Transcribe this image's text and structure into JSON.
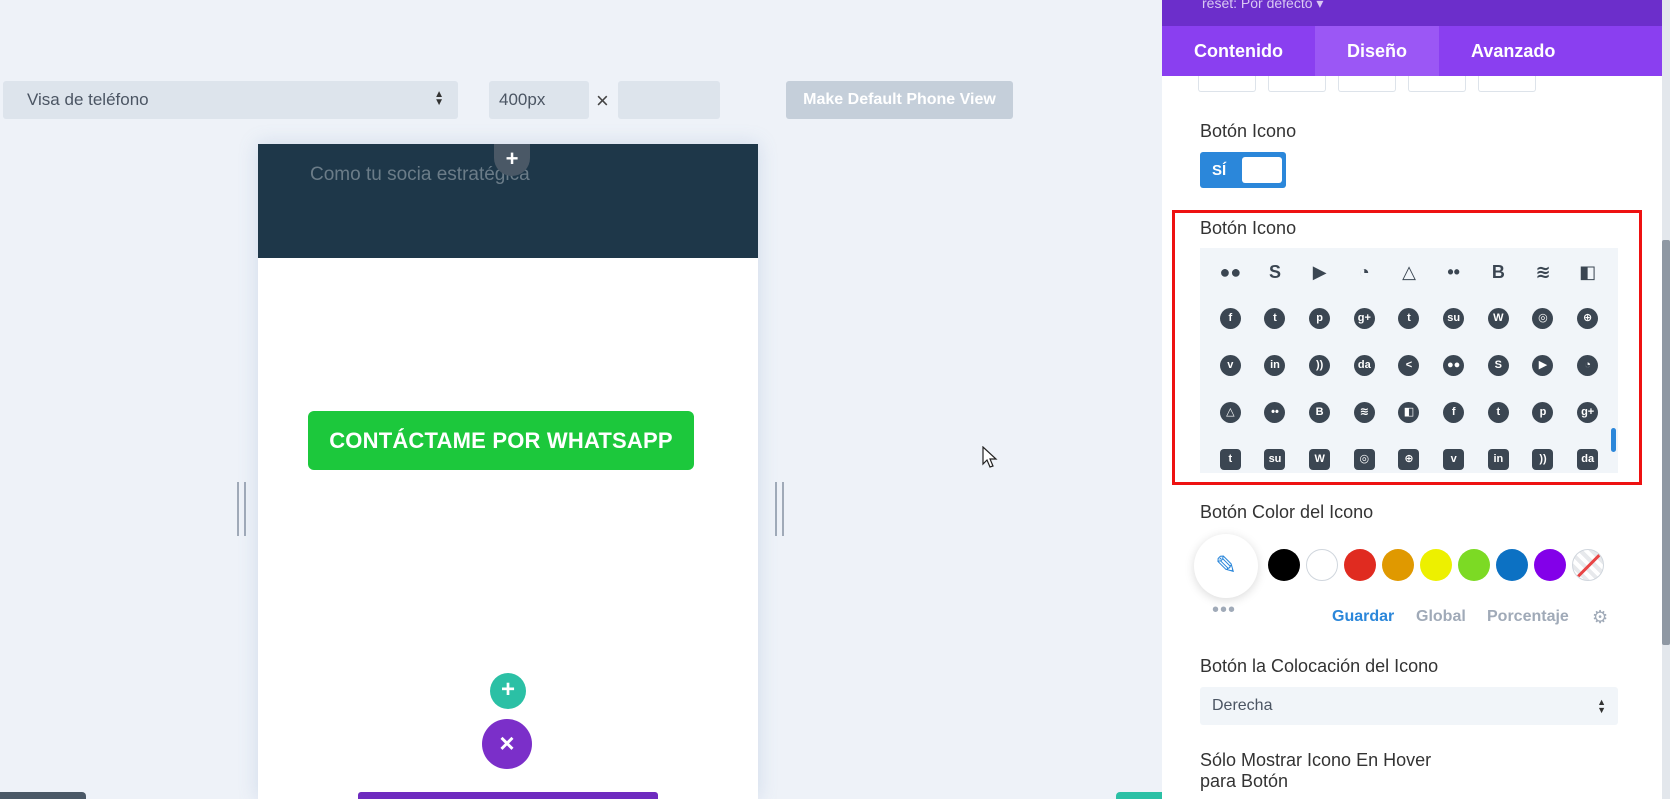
{
  "toolbar": {
    "view_select_value": "Visa de teléfono",
    "width_value": "400px",
    "times_symbol": "×",
    "height_value": "",
    "default_button_label": "Make Default Phone View"
  },
  "preview": {
    "hero_text": "Como tu socia estratégica",
    "whatsapp_button_label": "CONTÁCTAME POR WHATSAPP",
    "add_symbol": "+",
    "close_symbol": "×"
  },
  "panel": {
    "preset_label": "reset: Por defecto ▾",
    "tabs": [
      {
        "label": "Contenido"
      },
      {
        "label": "Diseño"
      },
      {
        "label": "Avanzado"
      }
    ],
    "button_icon_toggle_label": "Botón Icono",
    "toggle_value": "SÍ",
    "button_icon_label": "Botón Icono",
    "icon_rows": [
      [
        "myspace",
        "skype",
        "youtube",
        "picasa",
        "google-drive",
        "flickr",
        "blogger",
        "spotify",
        "delicious"
      ],
      [
        "facebook",
        "twitter",
        "pinterest",
        "google-plus",
        "tumblr",
        "stumbleupon",
        "wordpress",
        "instagram",
        "dribbble"
      ],
      [
        "vimeo",
        "linkedin",
        "rss",
        "deviantart",
        "share",
        "myspace",
        "skype",
        "youtube",
        "picasa"
      ],
      [
        "google-drive",
        "flickr",
        "blogger",
        "spotify",
        "delicious",
        "facebook",
        "twitter",
        "pinterest",
        "google-plus"
      ],
      [
        "tumblr",
        "stumbleupon",
        "wordpress",
        "instagram",
        "dribbble",
        "vimeo",
        "linkedin",
        "rss",
        "deviantart"
      ]
    ],
    "icon_color_label": "Botón Color del Icono",
    "swatches": [
      "#000000",
      "#ffffff",
      "#e02b20",
      "#e09900",
      "#edf000",
      "#7cda24",
      "#0c71c3",
      "#8300e9"
    ],
    "color_controls": {
      "dots": "•••",
      "save": "Guardar",
      "global": "Global",
      "percent": "Porcentaje"
    },
    "icon_placement_label": "Botón la Colocación del Icono",
    "icon_placement_value": "Derecha",
    "hover_only_label_line1": "Sólo Mostrar Icono En Hover",
    "hover_only_label_line2": "para Botón"
  },
  "colors": {
    "accent_purple": "#8a3ff0",
    "active_tab": "#9b57f5",
    "whatsapp_green": "#1cc83c",
    "toggle_blue": "#2b87da",
    "highlight_red": "#ee1111"
  }
}
